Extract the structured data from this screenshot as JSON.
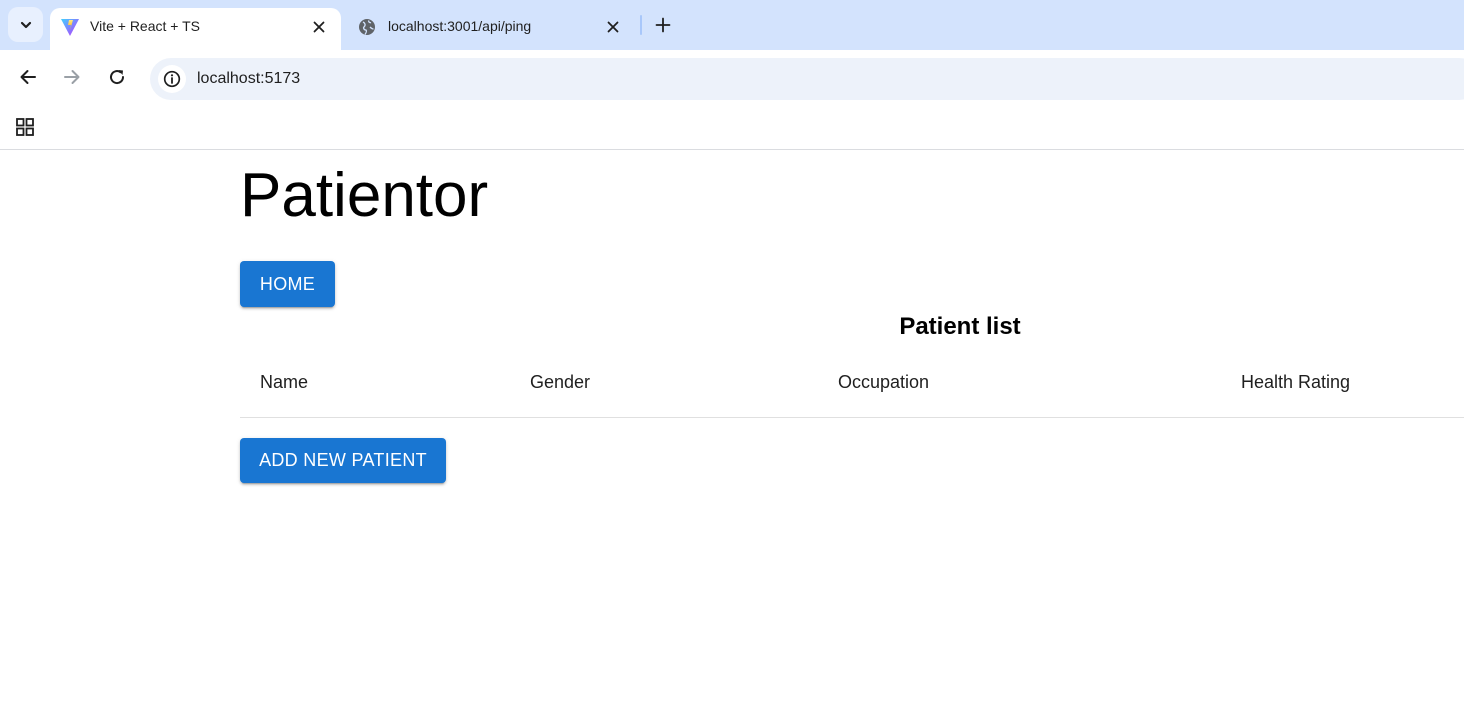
{
  "browser": {
    "tabs": [
      {
        "title": "Vite + React + TS",
        "favicon": "vite-logo-icon",
        "active": true
      },
      {
        "title": "localhost:3001/api/ping",
        "favicon": "globe-icon",
        "active": false
      }
    ],
    "address_bar": {
      "url": "localhost:5173"
    }
  },
  "page": {
    "title": "Patientor",
    "home_button": "Home",
    "list_title": "Patient list",
    "table": {
      "columns": [
        "Name",
        "Gender",
        "Occupation",
        "Health Rating"
      ],
      "rows": []
    },
    "add_button": "Add New Patient"
  },
  "colors": {
    "tabstrip": "#d3e3fd",
    "primary_button": "#1976d2",
    "omnibox": "#edf2fa"
  }
}
